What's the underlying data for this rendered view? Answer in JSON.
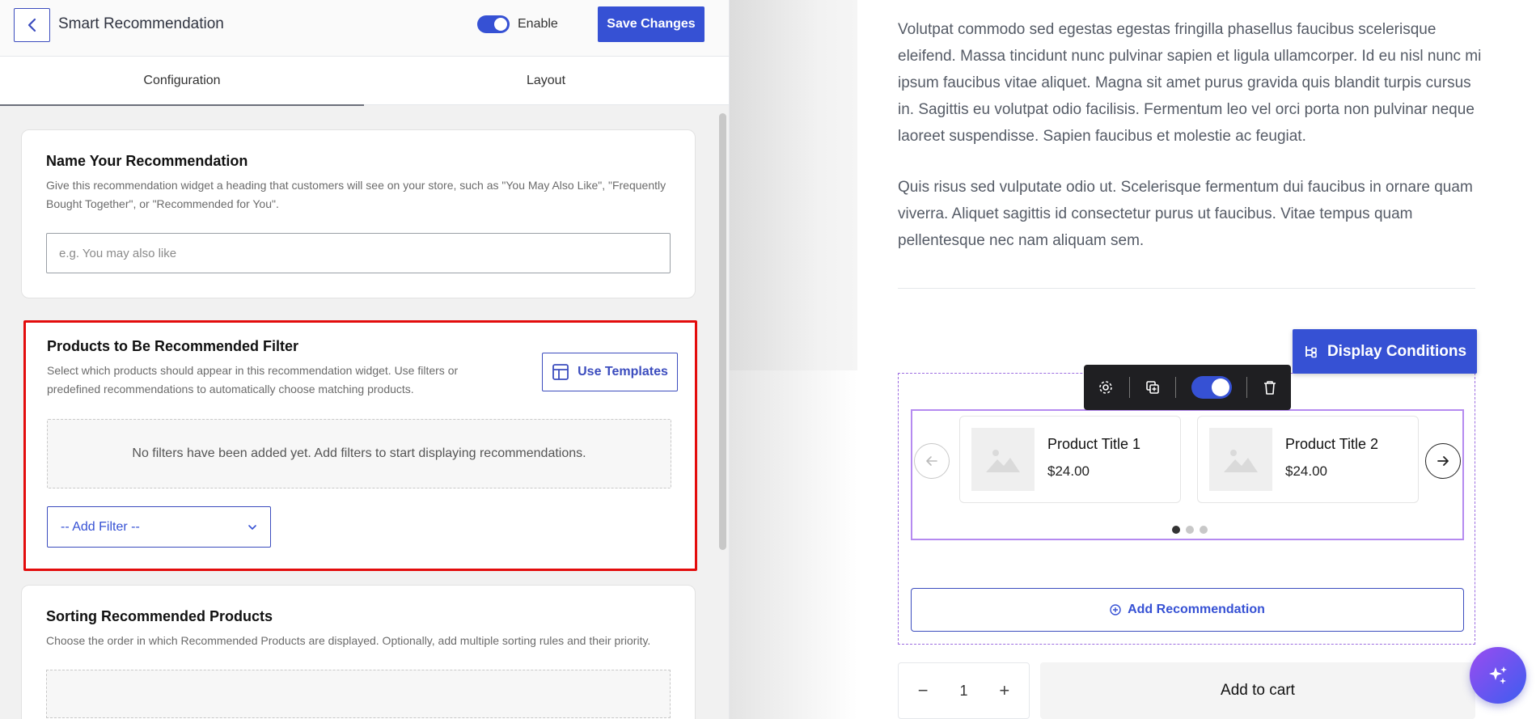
{
  "header": {
    "title": "Smart Recommendation",
    "enable_label": "Enable",
    "save_label": "Save Changes"
  },
  "tabs": [
    {
      "label": "Configuration",
      "active": true
    },
    {
      "label": "Layout",
      "active": false
    }
  ],
  "name_section": {
    "title": "Name Your Recommendation",
    "description": "Give this recommendation widget a heading that customers will see on your store, such as \"You May Also Like\", \"Frequently Bought Together\", or \"Recommended for You\".",
    "input_placeholder": "e.g. You may also like",
    "input_value": ""
  },
  "filter_section": {
    "title": "Products to Be Recommended Filter",
    "description": "Select which products should appear in this recommendation widget. Use filters or predefined recommendations to automatically choose matching products.",
    "templates_label": "Use Templates",
    "empty_text": "No filters have been added yet. Add filters to start displaying recommendations.",
    "add_filter_label": "-- Add Filter --"
  },
  "sorting_section": {
    "title": "Sorting Recommended Products",
    "description": "Choose the order in which Recommended Products are displayed. Optionally, add multiple sorting rules and their priority."
  },
  "preview": {
    "paragraph_1": "Volutpat commodo sed egestas egestas fringilla phasellus faucibus scelerisque eleifend. Massa tincidunt nunc pulvinar sapien et ligula ullamcorper. Id eu nisl nunc mi ipsum faucibus vitae aliquet. Magna sit amet purus gravida quis blandit turpis cursus in. Sagittis eu volutpat odio facilisis. Fermentum leo vel orci porta non pulvinar neque laoreet suspendisse. Sapien faucibus et molestie ac feugiat.",
    "paragraph_2": "Quis risus sed vulputate odio ut. Scelerisque fermentum dui faucibus in ornare quam viverra. Aliquet sagittis id consectetur purus ut faucibus. Vitae tempus quam pellentesque nec nam aliquam sem.",
    "display_conditions_label": "Display Conditions",
    "products": [
      {
        "title": "Product Title 1",
        "price": "$24.00"
      },
      {
        "title": "Product Title 2",
        "price": "$24.00"
      }
    ],
    "carousel_pages": 3,
    "carousel_active_page": 1,
    "add_recommendation_label": "Add Recommendation",
    "quantity": "1",
    "add_to_cart_label": "Add to cart"
  },
  "colors": {
    "accent": "#3651d4",
    "highlight_border": "#e30c0c",
    "widget_border": "#b58af0"
  }
}
